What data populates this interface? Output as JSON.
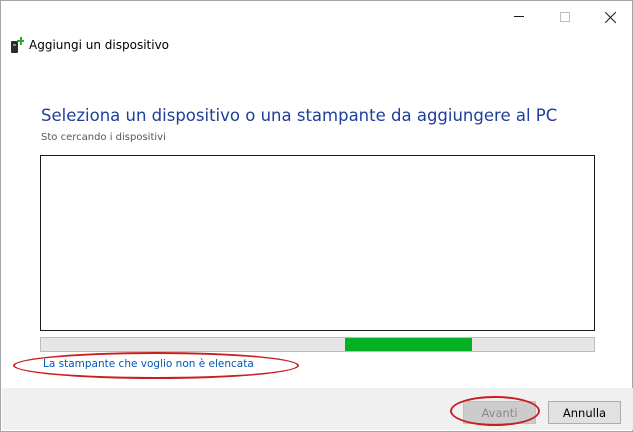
{
  "window": {
    "title": "Aggiungi un dispositivo"
  },
  "main": {
    "heading": "Seleziona un dispositivo o una stampante da aggiungere al PC",
    "status": "Sto cercando i dispositivi",
    "progress": {
      "start": 0.55,
      "end": 0.78
    },
    "printer_link": "La stampante che voglio non è elencata"
  },
  "footer": {
    "next_label": "Avanti",
    "cancel_label": "Annulla"
  },
  "colors": {
    "heading": "#1e3e9a",
    "link": "#0058b8",
    "progress_fill": "#06b025",
    "annotation": "#c81e1e"
  }
}
